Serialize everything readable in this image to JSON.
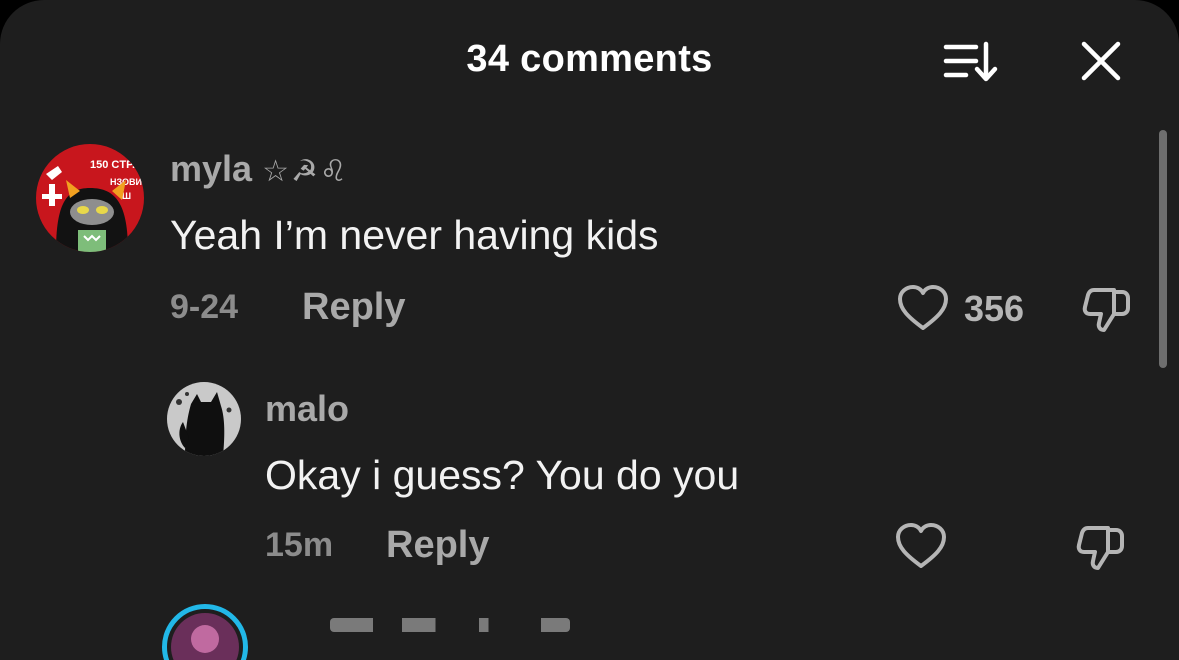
{
  "header": {
    "title": "34 comments"
  },
  "comments": [
    {
      "username": "myla",
      "flair": "☆☭♌︎",
      "text": "Yeah I’m never having kids",
      "time": "9-24",
      "reply_label": "Reply",
      "likes": "356"
    },
    {
      "username": "malo",
      "text": "Okay i guess? You do you",
      "time": "15m",
      "reply_label": "Reply"
    }
  ],
  "avatar_myla": {
    "line1": "150 CTP.",
    "line2": "НЗОВИ",
    "line3": "Ш"
  },
  "colors": {
    "background": "#1e1e1e",
    "muted_text": "#a9a9a9",
    "accent_red": "#c8161d",
    "next_avatar_ring": "#22b8e8"
  },
  "icons": {
    "sort": "sort-icon",
    "close": "close-icon",
    "like": "heart-icon",
    "dislike": "thumbs-down-icon"
  }
}
